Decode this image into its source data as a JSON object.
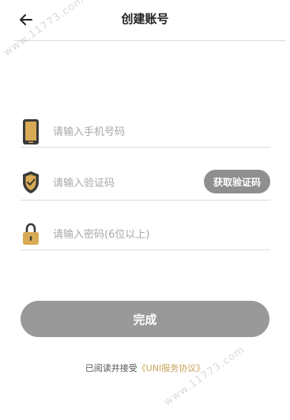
{
  "header": {
    "title": "创建账号",
    "back_icon": "back-arrow-icon"
  },
  "phone_field": {
    "icon": "phone-icon",
    "placeholder": "请输入手机号码",
    "value": ""
  },
  "code_field": {
    "icon": "shield-check-icon",
    "placeholder": "请输入验证码",
    "value": "",
    "get_code_label": "获取验证码"
  },
  "password_field": {
    "icon": "lock-icon",
    "placeholder": "请输入密码(6位以上)",
    "value": ""
  },
  "submit": {
    "label": "完成"
  },
  "agreement": {
    "prefix": "已阅读并接受",
    "link": "《UNI服务协议》"
  },
  "watermark": {
    "text": "www.11773.com"
  },
  "colors": {
    "accent": "#c9a55a",
    "icon_dark": "#3a3a3a",
    "button_gray": "#999999",
    "code_button_gray": "#8f8f8f"
  }
}
